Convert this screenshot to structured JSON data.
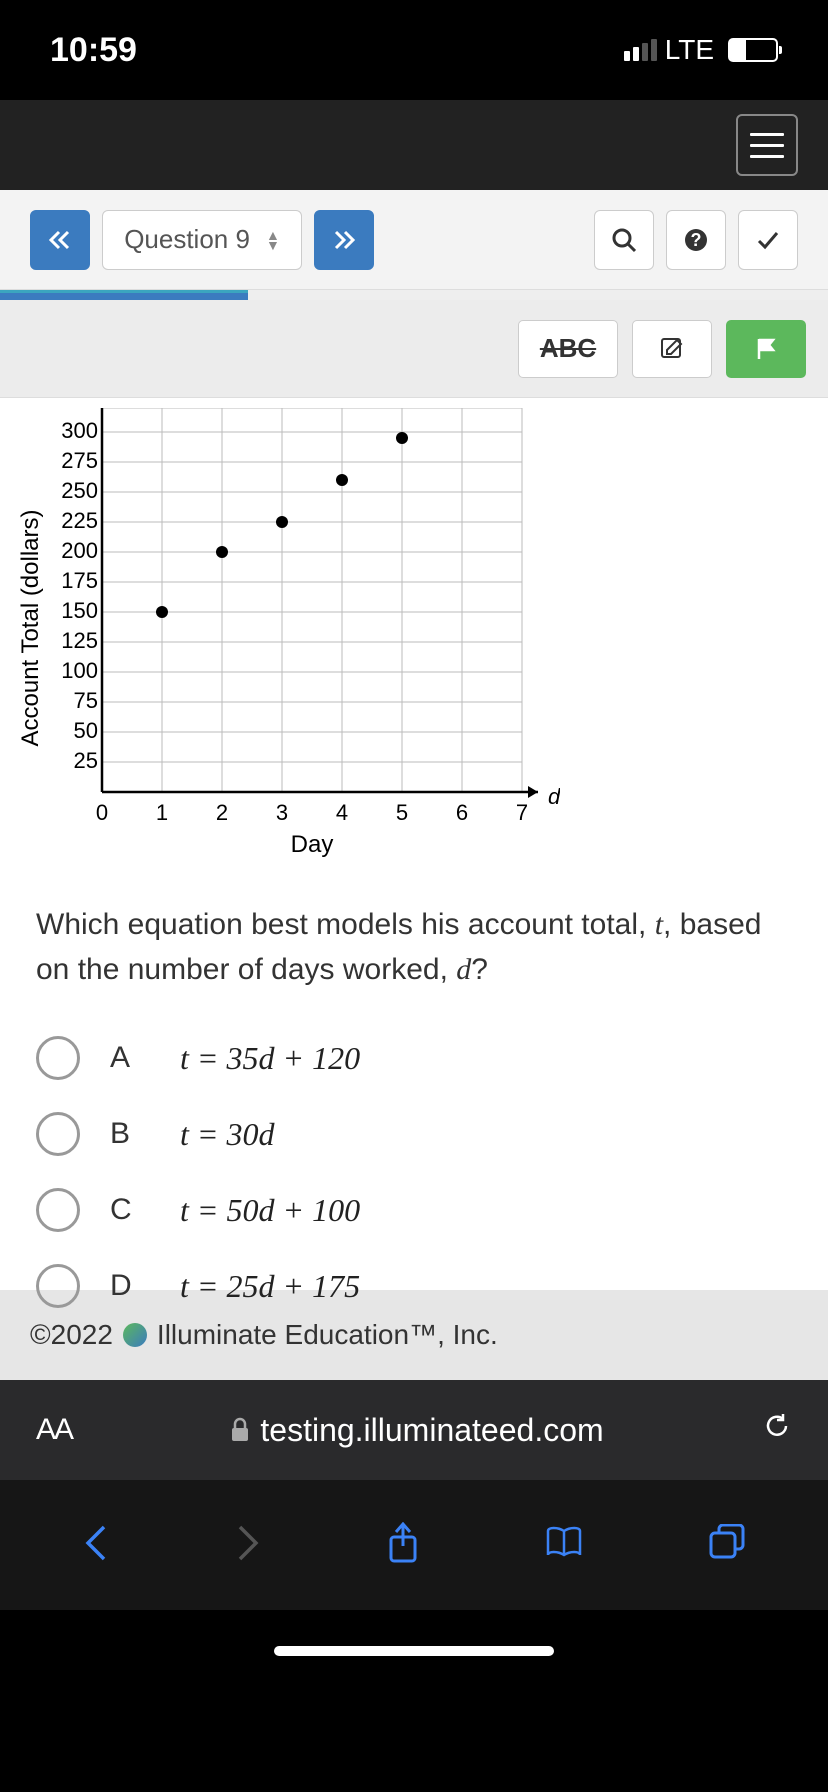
{
  "status": {
    "time": "10:59",
    "network": "LTE"
  },
  "toolbar": {
    "question_label": "Question 9"
  },
  "content_toolbar": {
    "abc_label": "ABC"
  },
  "chart_data": {
    "type": "scatter",
    "xlabel": "Day",
    "ylabel": "Account Total (dollars)",
    "x_ticks": [
      0,
      1,
      2,
      3,
      4,
      5,
      6,
      7
    ],
    "y_ticks": [
      25,
      50,
      75,
      100,
      125,
      150,
      175,
      200,
      225,
      250,
      275,
      300
    ],
    "xlim": [
      0,
      7
    ],
    "ylim": [
      0,
      300
    ],
    "points": [
      {
        "x": 1,
        "y": 150
      },
      {
        "x": 2,
        "y": 200
      },
      {
        "x": 3,
        "y": 225
      },
      {
        "x": 4,
        "y": 260
      },
      {
        "x": 5,
        "y": 295
      }
    ],
    "x_axis_var": "d"
  },
  "question": {
    "prompt_prefix": "Which equation best models his account total, ",
    "prompt_var1": "t",
    "prompt_mid": ", based on the number of days worked, ",
    "prompt_var2": "d",
    "prompt_suffix": "?"
  },
  "options": [
    {
      "letter": "A",
      "equation": "t = 35d + 120"
    },
    {
      "letter": "B",
      "equation": "t = 30d"
    },
    {
      "letter": "C",
      "equation": "t = 50d + 100"
    },
    {
      "letter": "D",
      "equation": "t = 25d + 175"
    }
  ],
  "footer": {
    "copyright": "©2022",
    "company": "Illuminate Education™, Inc."
  },
  "browser": {
    "aa": "AA",
    "url": "testing.illuminateed.com"
  }
}
